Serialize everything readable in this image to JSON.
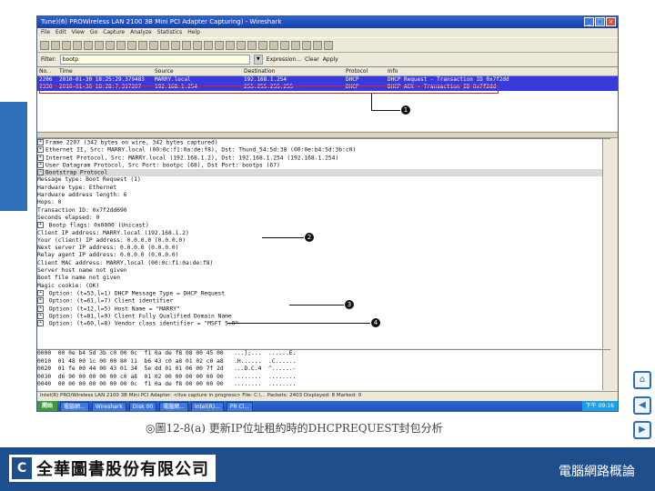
{
  "window": {
    "title": "Tune)(6) PROWireless LAN 2100 3B Mini PCI Adapter Capturing) - Wireshark",
    "menus": [
      "File",
      "Edit",
      "View",
      "Go",
      "Capture",
      "Analyze",
      "Statistics",
      "Help"
    ]
  },
  "filter": {
    "label": "Filter:",
    "value": "bootp",
    "buttons": [
      "Expression...",
      "Clear",
      "Apply"
    ]
  },
  "packet_list": {
    "headers": [
      "No. .",
      "Time",
      "Source",
      "Destination",
      "Protocol",
      "Info"
    ],
    "rows": [
      [
        "2206",
        "2010-01-30 18:25:29.379483",
        "MARRY.local",
        "192.168.1.254",
        "DHCP",
        "DHCP Request  - Transaction ID 0x7f2dd"
      ],
      [
        "2330",
        "2010-01-30 18:28:7.317207",
        "192.168.1.254",
        "255.255.255.255",
        "DHCP",
        "DHCP ACK      - Transaction ID 0x7f2dd"
      ]
    ]
  },
  "details": [
    {
      "exp": "+",
      "text": "Frame 2207 (342 bytes on wire, 342 bytes captured)"
    },
    {
      "exp": "+",
      "text": "Ethernet II, Src: MARRY.local (00:0c:f1:0a:de:f8), Dst: Thund_54:5d:38 (00:0e:b4:5d:3b:c0)"
    },
    {
      "exp": "+",
      "text": "Internet Protocol, Src: MARRY.local (192.168.1.2), Dst: 192.168.1.254 (192.168.1.254)"
    },
    {
      "exp": "+",
      "text": "User Datagram Protocol, Src Port: bootpc (68), Dst Port: bootps (67)"
    },
    {
      "exp": "-",
      "text": "Bootstrap Protocol",
      "sel": true
    },
    {
      "exp": "",
      "text": "    Message type: Boot Request (1)"
    },
    {
      "exp": "",
      "text": "    Hardware type: Ethernet"
    },
    {
      "exp": "",
      "text": "    Hardware address length: 6"
    },
    {
      "exp": "",
      "text": "    Hops: 0"
    },
    {
      "exp": "",
      "text": "    Transaction ID: 0x7f2dd690"
    },
    {
      "exp": "",
      "text": "    Seconds elapsed: 0"
    },
    {
      "exp": "+",
      "text": "  Bootp flags: 0x0000 (Unicast)"
    },
    {
      "exp": "",
      "text": "    Client IP address: MARRY.local (192.168.1.2)"
    },
    {
      "exp": "",
      "text": "    Your (client) IP address: 0.0.0.0 (0.0.0.0)"
    },
    {
      "exp": "",
      "text": "    Next server IP address: 0.0.0.0 (0.0.0.0)"
    },
    {
      "exp": "",
      "text": "    Relay agent IP address: 0.0.0.0 (0.0.0.0)"
    },
    {
      "exp": "",
      "text": "    Client MAC address: MARRY.local (00:0c:f1:0a:de:f8)"
    },
    {
      "exp": "",
      "text": "    Server host name not given"
    },
    {
      "exp": "",
      "text": "    Boot file name not given"
    },
    {
      "exp": "",
      "text": "    Magic cookie: (OK)"
    },
    {
      "exp": "+",
      "text": "  Option: (t=53,l=1) DHCP Message Type = DHCP Request"
    },
    {
      "exp": "+",
      "text": "  Option: (t=61,l=7) Client identifier"
    },
    {
      "exp": "+",
      "text": "  Option: (t=12,l=5) Host Name = \"MARRY\""
    },
    {
      "exp": "+",
      "text": "  Option: (t=81,l=9) Client Fully Qualified Domain Name"
    },
    {
      "exp": "+",
      "text": "  Option: (t=60,l=8) Vendor class identifier = \"MSFT 5.0\""
    }
  ],
  "hex": [
    "0000  00 0e b4 5d 3b c0 00 0c  f1 0a de f8 08 00 45 00   ...];...  ......E.",
    "0010  01 48 00 1c 00 00 80 11  b6 43 c0 a8 01 02 c0 a8   .H......  .C......",
    "0020  01 fe 00 44 00 43 01 34  5e dd 01 01 06 00 7f 2d   ...D.C.4  ^......-",
    "0030  d6 90 00 00 00 00 c0 a8  01 02 00 00 00 00 00 00   ........  ........",
    "0040  00 00 00 00 00 00 00 0c  f1 0a de f8 00 00 00 00   ........  ........"
  ],
  "status": "Intel(R) PRO/Wireless LAN 2100 3B Mini PCI Adapter: <live capture in progress> File: C:\\...   Packets: 2403 Displayed: 8 Marked: 0",
  "taskbar": {
    "start": "開始",
    "tasks": [
      "電腦網...",
      "Wireshark",
      "Disk 00",
      "電腦網...",
      "Intel(R)...",
      "PR Cl..."
    ],
    "clock": "下午 09:16"
  },
  "callouts": [
    "1",
    "2",
    "3",
    "4"
  ],
  "caption": "◎圖12-8(a) 更新IP位址租約時的DHCPREQUEST封包分析",
  "footer": {
    "company": "全華圖書股份有限公司",
    "course": "電腦網路概論"
  }
}
